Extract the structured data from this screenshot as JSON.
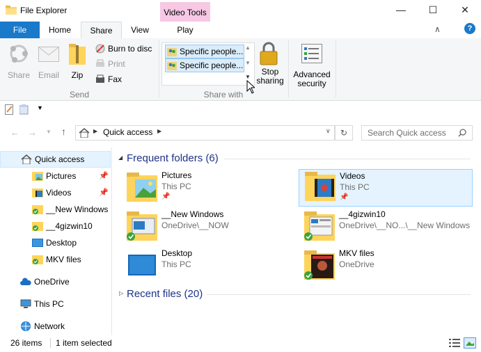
{
  "window": {
    "title": "File Explorer",
    "contextual_tab": "Video Tools",
    "minimize": "—",
    "maximize": "☐",
    "close": "✕"
  },
  "ribbon_tabs": {
    "file": "File",
    "home": "Home",
    "share": "Share",
    "view": "View",
    "play": "Play"
  },
  "ribbon": {
    "send": {
      "group_label": "Send",
      "share": "Share",
      "email": "Email",
      "zip": "Zip",
      "burn": "Burn to disc",
      "print": "Print",
      "fax": "Fax"
    },
    "share_with": {
      "group_label": "Share with",
      "items": [
        "Specific people...",
        "Specific people..."
      ],
      "stop_sharing": "Stop sharing",
      "stop_line1": "Stop",
      "stop_line2": "sharing"
    },
    "advanced": {
      "line1": "Advanced",
      "line2": "security"
    }
  },
  "address": {
    "location": "Quick access",
    "search_placeholder": "Search Quick access"
  },
  "nav": {
    "items": [
      {
        "label": "Quick access",
        "icon": "star-icon"
      },
      {
        "label": "Pictures",
        "icon": "pictures-folder-icon"
      },
      {
        "label": "Videos",
        "icon": "videos-folder-icon"
      },
      {
        "label": "__New Windows",
        "icon": "synced-folder-icon"
      },
      {
        "label": "__4gizwin10",
        "icon": "synced-folder-icon"
      },
      {
        "label": "Desktop",
        "icon": "desktop-icon"
      },
      {
        "label": "MKV files",
        "icon": "synced-folder-icon"
      },
      {
        "label": "OneDrive",
        "icon": "cloud-icon"
      },
      {
        "label": "This PC",
        "icon": "computer-icon"
      },
      {
        "label": "Network",
        "icon": "network-icon"
      }
    ]
  },
  "content": {
    "frequent_header": "Frequent folders (6)",
    "recent_header": "Recent files (20)",
    "folders": [
      {
        "name": "Pictures",
        "location": "This PC"
      },
      {
        "name": "Videos",
        "location": "This PC"
      },
      {
        "name": "__New Windows",
        "location": "OneDrive\\__NOW"
      },
      {
        "name": "__4gizwin10",
        "location": "OneDrive\\__NO...\\__New Windows"
      },
      {
        "name": "Desktop",
        "location": "This PC"
      },
      {
        "name": "MKV files",
        "location": "OneDrive"
      }
    ]
  },
  "status": {
    "items_count": "26 items",
    "selection": "1 item selected"
  },
  "colors": {
    "accent": "#1979ca",
    "context_tab": "#f6c8e4",
    "selection": "#e5f3ff",
    "folder_yellow": "#ffd45a",
    "sync_green": "#3aa33a"
  }
}
